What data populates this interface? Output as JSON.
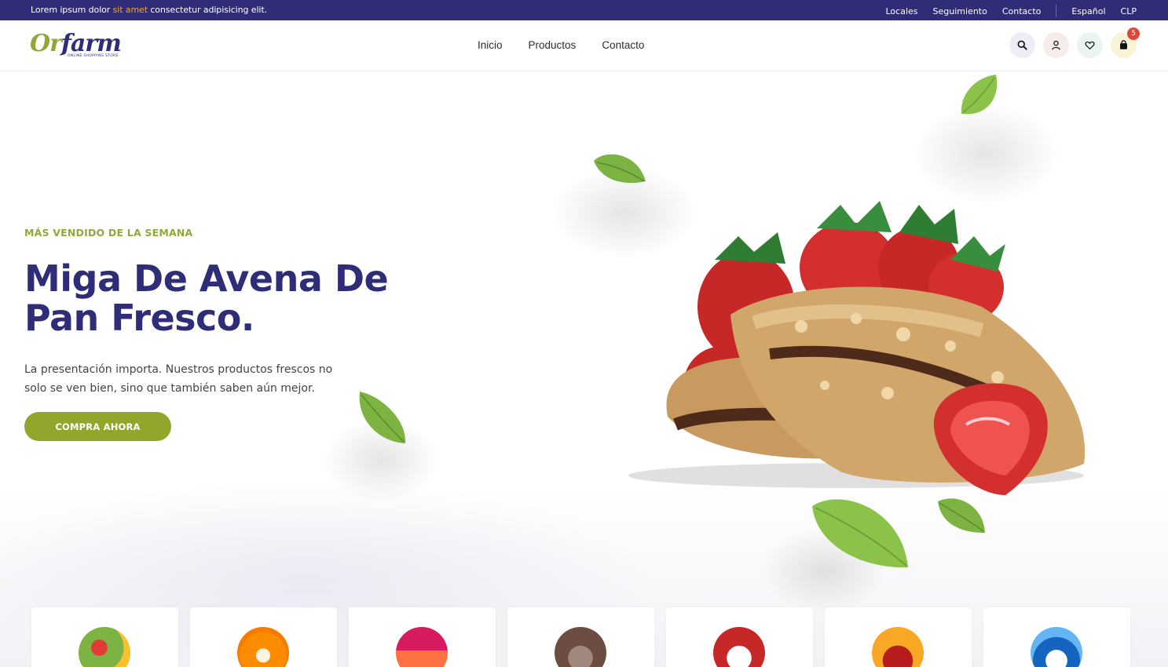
{
  "topbar": {
    "promo_before": "Lorem ipsum dolor ",
    "promo_highlight": "sit amet",
    "promo_after": " consectetur adipisicing elit.",
    "links": [
      "Locales",
      "Seguimiento",
      "Contacto"
    ],
    "language": "Español",
    "currency": "CLP"
  },
  "header": {
    "logo_text_1": "Or",
    "logo_text_2": "farm",
    "logo_tagline": "ONLINE SHOPPING STORE",
    "nav": [
      "Inicio",
      "Productos",
      "Contacto"
    ],
    "cart_count": "5"
  },
  "hero": {
    "kicker": "MÁS VENDIDO DE LA SEMANA",
    "title": "Miga De Avena De Pan Fresco.",
    "description": "La presentación importa. Nuestros productos frescos no solo se ven bien, sino que también saben aún mejor.",
    "cta": "COMPRA AHORA"
  },
  "categories": [
    {
      "icon": "vegetables-icon"
    },
    {
      "icon": "oranges-icon"
    },
    {
      "icon": "juice-icon"
    },
    {
      "icon": "bread-icon"
    },
    {
      "icon": "packaged-food-icon"
    },
    {
      "icon": "meat-icon"
    },
    {
      "icon": "milk-icon"
    }
  ],
  "colors": {
    "brand_primary": "#2f2d78",
    "brand_accent": "#92a62c",
    "highlight": "#f2a531",
    "badge": "#e0453b"
  }
}
